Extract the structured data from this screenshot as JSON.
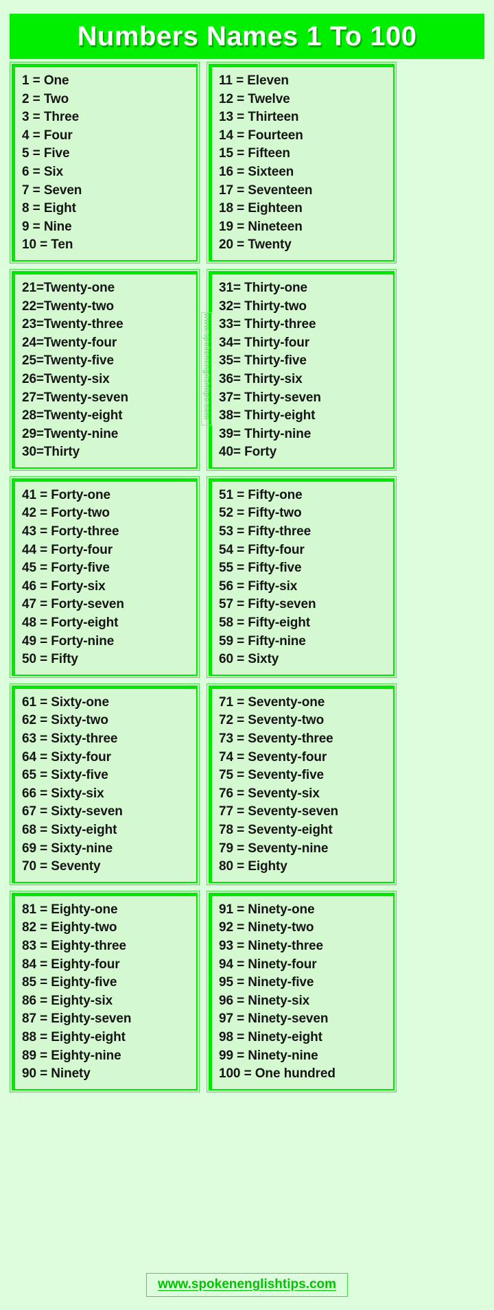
{
  "header": {
    "title": "Numbers Names 1 To 100",
    "title_bg": "#00ee00",
    "title_color": "#ffffff"
  },
  "theme": {
    "page_bg": "#ddfedd",
    "box_bg": "#d4f8d0",
    "border_green": "#00e800",
    "text_black": "#151515",
    "link_green": "#00c400"
  },
  "watermark": {
    "text": "www.spokenenglishtips.com"
  },
  "footer": {
    "link_text": "www.spokenenglishtips.com"
  },
  "boxes": [
    {
      "id": "box-1-10",
      "range": "1-10",
      "lines": [
        "1 = One",
        "2 = Two",
        "3 = Three",
        "4 = Four",
        "5 = Five",
        "6 = Six",
        "7 = Seven",
        "8 = Eight",
        "9 = Nine",
        "10 = Ten"
      ]
    },
    {
      "id": "box-11-20",
      "range": "11-20",
      "lines": [
        "11 = Eleven",
        "12 = Twelve",
        "13 = Thirteen",
        "14 = Fourteen",
        "15 = Fifteen",
        "16 = Sixteen",
        "17 = Seventeen",
        "18 = Eighteen",
        "19 = Nineteen",
        "20 = Twenty"
      ]
    },
    {
      "id": "box-21-30",
      "range": "21-30",
      "lines": [
        "21=Twenty-one",
        "22=Twenty-two",
        "23=Twenty-three",
        "24=Twenty-four",
        "25=Twenty-five",
        "26=Twenty-six",
        "27=Twenty-seven",
        "28=Twenty-eight",
        "29=Twenty-nine",
        "30=Thirty"
      ]
    },
    {
      "id": "box-31-40",
      "range": "31-40",
      "lines": [
        "31= Thirty-one",
        "32= Thirty-two",
        "33= Thirty-three",
        "34= Thirty-four",
        "35= Thirty-five",
        "36= Thirty-six",
        "37= Thirty-seven",
        "38= Thirty-eight",
        "39= Thirty-nine",
        "40= Forty"
      ]
    },
    {
      "id": "box-41-50",
      "range": "41-50",
      "lines": [
        "41 = Forty-one",
        "42 = Forty-two",
        "43 = Forty-three",
        "44 = Forty-four",
        "45 = Forty-five",
        "46 = Forty-six",
        "47 = Forty-seven",
        "48 = Forty-eight",
        "49 = Forty-nine",
        "50 = Fifty"
      ]
    },
    {
      "id": "box-51-60",
      "range": "51-60",
      "lines": [
        "51 = Fifty-one",
        "52 = Fifty-two",
        "53 = Fifty-three",
        "54 = Fifty-four",
        "55 = Fifty-five",
        "56 = Fifty-six",
        "57 = Fifty-seven",
        "58 = Fifty-eight",
        "59 = Fifty-nine",
        "60 = Sixty"
      ]
    },
    {
      "id": "box-61-70",
      "range": "61-70",
      "lines": [
        "61 = Sixty-one",
        "62 = Sixty-two",
        "63 = Sixty-three",
        "64 = Sixty-four",
        "65 = Sixty-five",
        "66 = Sixty-six",
        "67 = Sixty-seven",
        "68 = Sixty-eight",
        "69 = Sixty-nine",
        "70 = Seventy"
      ]
    },
    {
      "id": "box-71-80",
      "range": "71-80",
      "lines": [
        "71 = Seventy-one",
        "72 = Seventy-two",
        "73 = Seventy-three",
        "74 = Seventy-four",
        "75 = Seventy-five",
        "76 = Seventy-six",
        "77 = Seventy-seven",
        "78 = Seventy-eight",
        "79 = Seventy-nine",
        "80 = Eighty"
      ]
    },
    {
      "id": "box-81-90",
      "range": "81-90",
      "lines": [
        "81 = Eighty-one",
        "82 = Eighty-two",
        "83 = Eighty-three",
        "84 = Eighty-four",
        "85 = Eighty-five",
        "86 = Eighty-six",
        "87 = Eighty-seven",
        "88 = Eighty-eight",
        "89 = Eighty-nine",
        "90 = Ninety"
      ]
    },
    {
      "id": "box-91-100",
      "range": "91-100",
      "lines": [
        "91 = Ninety-one",
        "92 = Ninety-two",
        "93 = Ninety-three",
        "94 = Ninety-four",
        "95 = Ninety-five",
        "96 = Ninety-six",
        "97 = Ninety-seven",
        "98 = Ninety-eight",
        "99 = Ninety-nine",
        "100 = One hundred"
      ]
    }
  ]
}
